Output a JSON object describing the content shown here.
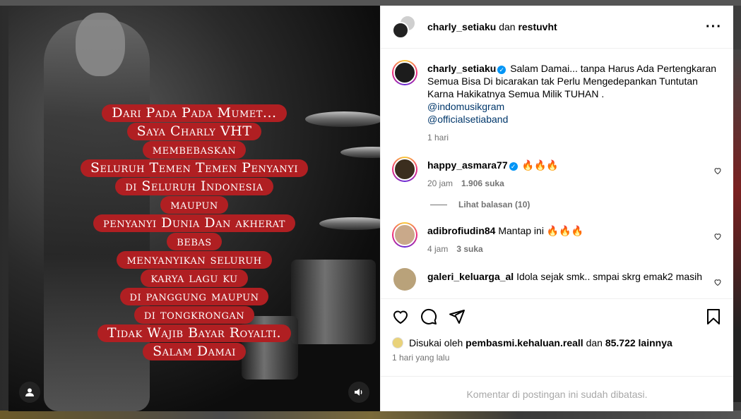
{
  "header": {
    "username": "charly_setiaku",
    "connector": "dan",
    "collaborator": "restuvht",
    "more_icon": "more-horizontal-icon"
  },
  "media": {
    "lyrics": [
      "Dari Pada Pada Mumet...",
      "Saya Charly VHT",
      "membebaskan",
      "Seluruh Temen Temen Penyanyi",
      "di Seluruh Indonesia",
      "maupun",
      "penyanyi Dunia Dan akherat",
      "bebas",
      "menyanyikan seluruh",
      "karya lagu ku",
      "di panggung maupun",
      "di tongkrongan",
      "Tidak  Wajib Bayar Royalti.",
      "Salam Damai"
    ],
    "tagged_icon": "user-tag-icon",
    "audio_icon": "speaker-icon"
  },
  "caption": {
    "username": "charly_setiaku",
    "text": "Salam Damai... tanpa Harus Ada Pertengkaran Semua Bisa Di bicarakan tak Perlu Mengedepankan Tuntutan Karna Hakikatnya Semua Milik TUHAN .",
    "mentions": [
      "@indomusikgram",
      "@officialsetiaband"
    ],
    "time": "1 hari"
  },
  "comments": [
    {
      "username": "happy_asmara77",
      "verified": true,
      "text": "🔥🔥🔥",
      "time": "20 jam",
      "likes": "1.906 suka",
      "view_replies": "Lihat balasan (10)"
    },
    {
      "username": "adibrofiudin84",
      "verified": false,
      "text": "Mantap ini 🔥🔥🔥",
      "time": "4 jam",
      "likes": "3 suka"
    },
    {
      "username": "galeri_keluarga_al",
      "verified": false,
      "text": "Idola sejak smk.. smpai skrg emak2 masih",
      "time": "",
      "likes": ""
    }
  ],
  "actions": {
    "like_icon": "heart-icon",
    "comment_icon": "comment-icon",
    "share_icon": "share-icon",
    "save_icon": "bookmark-icon",
    "liked_by_prefix": "Disukai oleh",
    "liked_by_user": "pembasmi.kehaluan.reall",
    "liked_by_and": "dan",
    "liked_by_others": "85.722 lainnya",
    "time_ago": "1 hari yang lalu",
    "comments_limited": "Komentar di postingan ini sudah dibatasi."
  },
  "colors": {
    "lyric_bg": "#b01f22",
    "verified": "#0095f6",
    "mention": "#00376b"
  }
}
